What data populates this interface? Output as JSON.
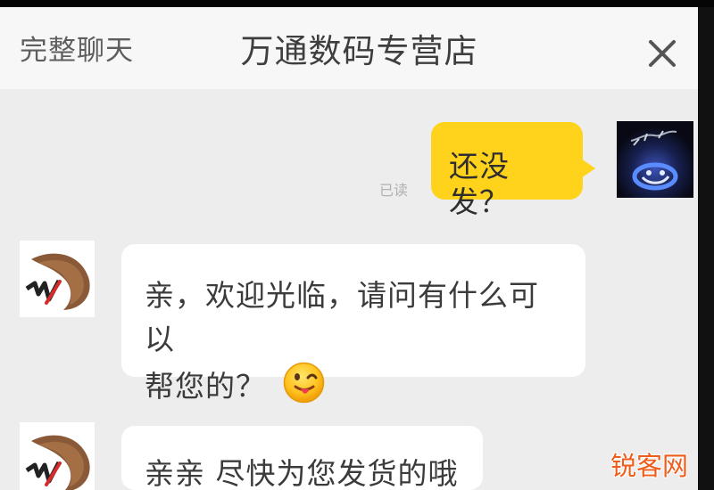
{
  "header": {
    "full_chat_label": "完整聊天",
    "store_name": "万通数码专营店",
    "close_icon": "close-icon"
  },
  "conversation": {
    "self_message": {
      "text": "还没发？",
      "status": "已读",
      "bubble_color": "#ffd21b",
      "avatar_icon": "user-avatar-icon"
    },
    "shop_messages": [
      {
        "line_1": "亲，欢迎光临，请问有什么可以",
        "line_2": "帮您的？",
        "emoji": "tongue-out-emoji-icon",
        "avatar_icon": "shop-logo-icon"
      },
      {
        "text": "亲亲 尽快为您发货的哦",
        "avatar_icon": "shop-logo-icon"
      }
    ]
  },
  "watermark": {
    "text": "锐客网",
    "color": "#ee5d1b"
  }
}
